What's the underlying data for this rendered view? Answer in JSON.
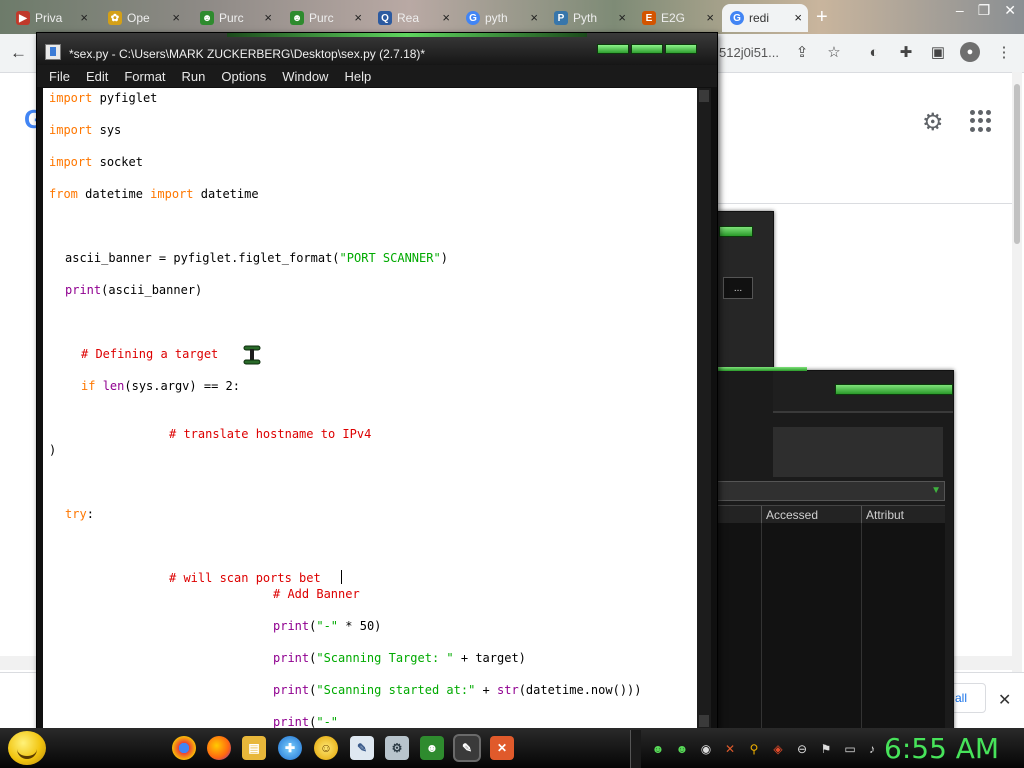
{
  "browser": {
    "tabs": [
      {
        "label": "Priva",
        "favicon": "video-icon",
        "color": "#c0392b"
      },
      {
        "label": "Ope",
        "favicon": "openai-icon",
        "color": "#d4a017"
      },
      {
        "label": "Purc",
        "favicon": "alien-icon",
        "color": "#2e8b2e"
      },
      {
        "label": "Purc",
        "favicon": "alien-icon",
        "color": "#2e8b2e"
      },
      {
        "label": "Rea",
        "favicon": "q-icon",
        "color": "#2c5aa0"
      },
      {
        "label": "pyth",
        "favicon": "google-icon",
        "color": "#4285f4"
      },
      {
        "label": "Pyth",
        "favicon": "python-icon",
        "color": "#3776ab"
      },
      {
        "label": "E2G",
        "favicon": "e2g-icon",
        "color": "#d35400"
      },
      {
        "label": "redi",
        "favicon": "google-icon",
        "color": "#4285f4",
        "active": true
      }
    ],
    "url_tail": "512j0i51...",
    "show_all_label": "all"
  },
  "dark_window": {
    "button_label": "...",
    "columns": [
      "Accessed",
      "Attribut"
    ]
  },
  "idle": {
    "title": "*sex.py - C:\\Users\\MARK ZUCKERBERG\\Desktop\\sex.py (2.7.18)*",
    "menu": [
      "File",
      "Edit",
      "Format",
      "Run",
      "Options",
      "Window",
      "Help"
    ],
    "code": [
      {
        "parts": [
          [
            "kw",
            "import"
          ],
          [
            "",
            "pyfiglet"
          ]
        ]
      },
      {
        "parts": [
          [
            "kw",
            "import"
          ],
          [
            "",
            "sys"
          ]
        ]
      },
      {
        "parts": [
          [
            "kw",
            "import"
          ],
          [
            "",
            "socket"
          ]
        ]
      },
      {
        "parts": [
          [
            "kw",
            "from"
          ],
          [
            "",
            "datetime"
          ],
          [
            "kw",
            "import"
          ],
          [
            "",
            "datetime"
          ]
        ]
      },
      {
        "parts": [
          [
            "",
            "ascii_banner = pyfiglet.figlet_format("
          ],
          [
            "st",
            "\"PORT SCANNER\""
          ],
          [
            "",
            ")"
          ]
        ]
      },
      {
        "parts": [
          [
            "bi",
            "print"
          ],
          [
            "",
            "(ascii_banner)"
          ]
        ]
      },
      {
        "parts": [
          [
            "cm",
            "# Defining a target"
          ]
        ]
      },
      {
        "parts": [
          [
            "kw",
            "if"
          ],
          [
            "bi",
            "len"
          ],
          [
            "",
            "(sys.argv) == 2:"
          ]
        ]
      },
      {
        "parts": [
          [
            "cm",
            "# translate hostname to IPv4"
          ]
        ]
      },
      {
        "parts": [
          [
            "",
            ")"
          ]
        ]
      },
      {
        "parts": [
          [
            "kw",
            "try"
          ],
          [
            "",
            ":"
          ]
        ]
      },
      {
        "parts": [
          [
            "cm",
            "# will scan ports bet"
          ]
        ]
      },
      {
        "parts": [
          [
            "cm",
            "# Add Banner"
          ]
        ]
      },
      {
        "parts": [
          [
            "bi",
            "print"
          ],
          [
            "",
            "("
          ],
          [
            "st",
            "\"-\""
          ],
          [
            "",
            " * 50)"
          ]
        ]
      },
      {
        "parts": [
          [
            "bi",
            "print"
          ],
          [
            "",
            "("
          ],
          [
            "st",
            "\"Scanning Target: \""
          ],
          [
            "",
            " + target)"
          ]
        ]
      },
      {
        "parts": [
          [
            "bi",
            "print"
          ],
          [
            "",
            "("
          ],
          [
            "st",
            "\"Scanning started at:\""
          ],
          [
            "",
            " + "
          ],
          [
            "bi",
            "str"
          ],
          [
            "",
            "(datetime.now()))"
          ]
        ]
      },
      {
        "parts": [
          [
            "bi",
            "print"
          ],
          [
            "",
            "("
          ],
          [
            "st",
            "\"-\""
          ]
        ]
      }
    ]
  },
  "taskbar": {
    "clock": "6:55 AM"
  },
  "colors": {
    "idle_green": "#5fd65f",
    "clock": "#47e35a",
    "keyword": "#ff7700",
    "builtin": "#900090",
    "string": "#00aa00",
    "comment": "#dd0000"
  }
}
